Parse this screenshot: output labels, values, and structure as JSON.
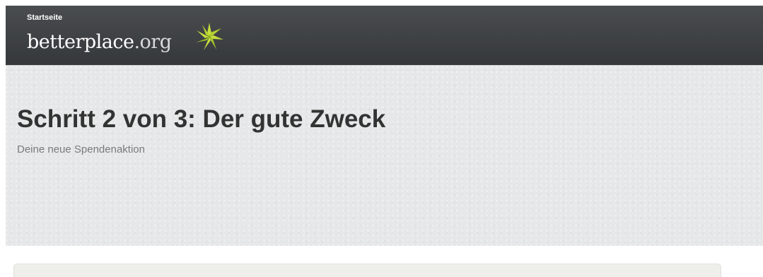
{
  "header": {
    "home_label": "Startseite",
    "logo": {
      "name": "betterplace",
      "suffix": ".org",
      "star_colors": [
        "#c6dd3c",
        "#9cc22a"
      ]
    },
    "background": "#3f4245"
  },
  "hero": {
    "title": "Schritt 2 von 3: Der gute Zweck",
    "subtitle": "Deine neue Spendenaktion",
    "background": "#e6e7e8"
  },
  "content_box": {
    "background": "#eeefea"
  }
}
